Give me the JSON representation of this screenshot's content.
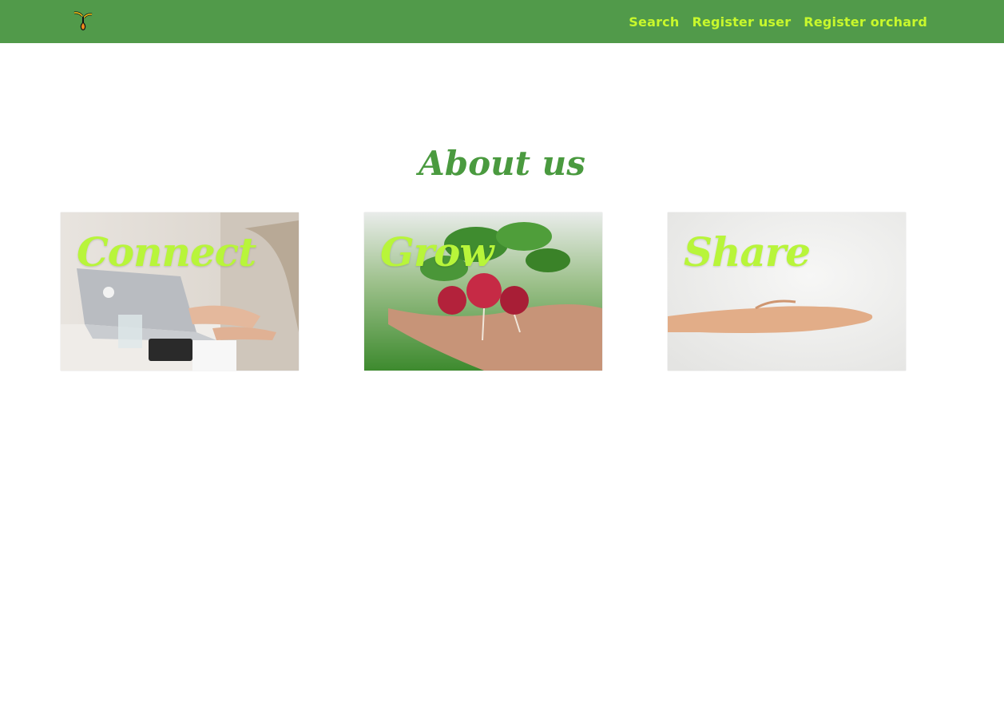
{
  "navbar": {
    "logo_icon": "sprout-logo-icon",
    "links": [
      {
        "label": "Search"
      },
      {
        "label": "Register user"
      },
      {
        "label": "Register orchard"
      }
    ],
    "link_color": "#c8f82c",
    "background": "#519a4a"
  },
  "main": {
    "heading": "About us",
    "heading_color": "#4a9a3f",
    "cards": [
      {
        "title": "Connect",
        "image": "woman-typing-on-laptop-photo"
      },
      {
        "title": "Grow",
        "image": "hand-holding-radishes-photo"
      },
      {
        "title": "Share",
        "image": "open-hand-photo"
      }
    ],
    "card_title_color": "#b8f53a"
  }
}
